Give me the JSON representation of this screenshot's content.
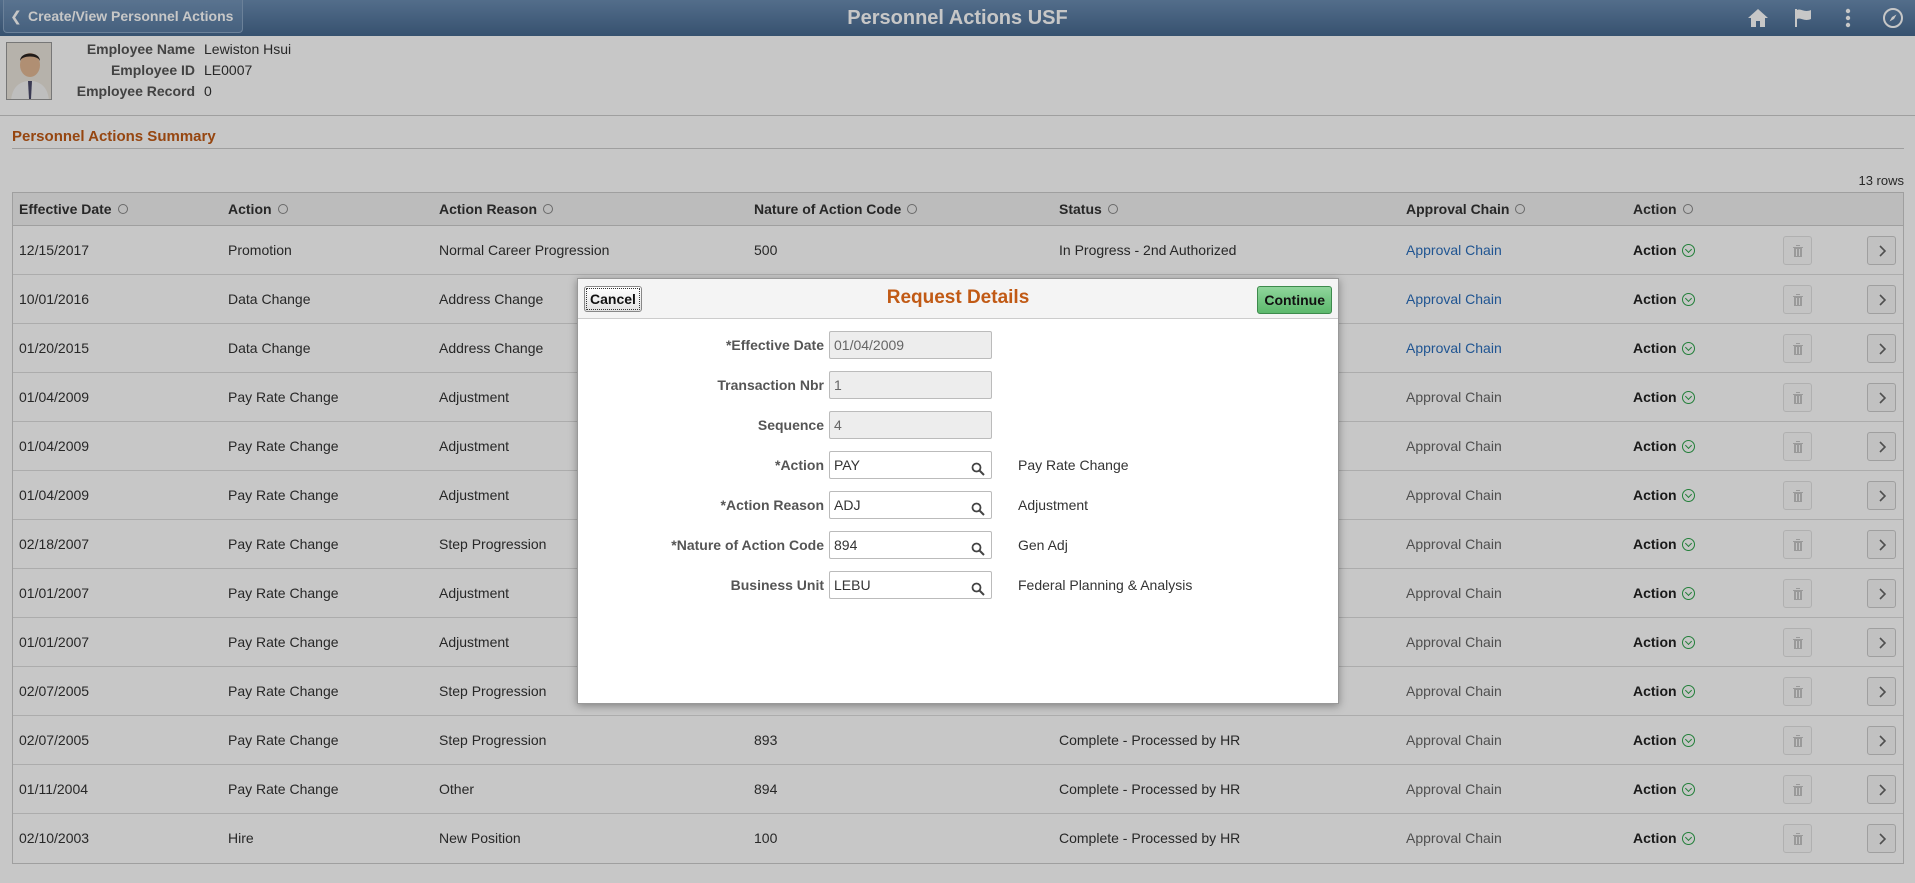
{
  "banner": {
    "back_label": "Create/View Personnel Actions",
    "title": "Personnel Actions USF",
    "icons": [
      "home-icon",
      "flag-icon",
      "more-vertical-icon",
      "navbar-compass-icon"
    ]
  },
  "employee": {
    "name_label": "Employee Name",
    "name": "Lewiston Hsui",
    "id_label": "Employee ID",
    "id": "LE0007",
    "record_label": "Employee Record",
    "record": "0"
  },
  "section": {
    "title": "Personnel Actions Summary",
    "row_count": "13 rows"
  },
  "grid": {
    "columns": [
      "Effective Date",
      "Action",
      "Action Reason",
      "Nature of Action Code",
      "Status",
      "Approval Chain",
      "Action"
    ],
    "rows": [
      {
        "date": "12/15/2017",
        "action": "Promotion",
        "reason": "Normal Career Progression",
        "noac": "500",
        "status": "In Progress - 2nd Authorized",
        "chain": "Approval Chain",
        "act": "Action"
      },
      {
        "date": "10/01/2016",
        "action": "Data Change",
        "reason": "Address Change",
        "noac": "",
        "status": "",
        "chain": "Approval Chain",
        "act": "Action"
      },
      {
        "date": "01/20/2015",
        "action": "Data Change",
        "reason": "Address Change",
        "noac": "",
        "status": "",
        "chain": "Approval Chain",
        "act": "Action"
      },
      {
        "date": "01/04/2009",
        "action": "Pay Rate Change",
        "reason": "Adjustment",
        "noac": "",
        "status": "",
        "chain": "Approval Chain",
        "act": "Action"
      },
      {
        "date": "01/04/2009",
        "action": "Pay Rate Change",
        "reason": "Adjustment",
        "noac": "",
        "status": "",
        "chain": "Approval Chain",
        "act": "Action"
      },
      {
        "date": "01/04/2009",
        "action": "Pay Rate Change",
        "reason": "Adjustment",
        "noac": "",
        "status": "",
        "chain": "Approval Chain",
        "act": "Action"
      },
      {
        "date": "02/18/2007",
        "action": "Pay Rate Change",
        "reason": "Step Progression",
        "noac": "",
        "status": "",
        "chain": "Approval Chain",
        "act": "Action"
      },
      {
        "date": "01/01/2007",
        "action": "Pay Rate Change",
        "reason": "Adjustment",
        "noac": "",
        "status": "",
        "chain": "Approval Chain",
        "act": "Action"
      },
      {
        "date": "01/01/2007",
        "action": "Pay Rate Change",
        "reason": "Adjustment",
        "noac": "",
        "status": "",
        "chain": "Approval Chain",
        "act": "Action"
      },
      {
        "date": "02/07/2005",
        "action": "Pay Rate Change",
        "reason": "Step Progression",
        "noac": "",
        "status": "",
        "chain": "Approval Chain",
        "act": "Action"
      },
      {
        "date": "02/07/2005",
        "action": "Pay Rate Change",
        "reason": "Step Progression",
        "noac": "893",
        "status": "Complete - Processed by HR",
        "chain": "Approval Chain",
        "act": "Action"
      },
      {
        "date": "01/11/2004",
        "action": "Pay Rate Change",
        "reason": "Other",
        "noac": "894",
        "status": "Complete - Processed by HR",
        "chain": "Approval Chain",
        "act": "Action"
      },
      {
        "date": "02/10/2003",
        "action": "Hire",
        "reason": "New Position",
        "noac": "100",
        "status": "Complete - Processed by HR",
        "chain": "Approval Chain",
        "act": "Action"
      }
    ],
    "linked_chain_rows": 3
  },
  "modal": {
    "title": "Request Details",
    "cancel_label": "Cancel",
    "continue_label": "Continue",
    "fields": [
      {
        "label": "*Effective Date",
        "value": "01/04/2009",
        "readonly": true,
        "lookup": false,
        "desc": ""
      },
      {
        "label": "Transaction Nbr",
        "value": "1",
        "readonly": true,
        "lookup": false,
        "desc": ""
      },
      {
        "label": "Sequence",
        "value": "4",
        "readonly": true,
        "lookup": false,
        "desc": ""
      },
      {
        "label": "*Action",
        "value": "PAY",
        "readonly": false,
        "lookup": true,
        "desc": "Pay Rate Change"
      },
      {
        "label": "*Action Reason",
        "value": "ADJ",
        "readonly": false,
        "lookup": true,
        "desc": "Adjustment"
      },
      {
        "label": "*Nature of Action Code",
        "value": "894",
        "readonly": false,
        "lookup": true,
        "desc": "Gen Adj"
      },
      {
        "label": "Business Unit",
        "value": "LEBU",
        "readonly": false,
        "lookup": true,
        "desc": "Federal Planning & Analysis"
      }
    ]
  },
  "colors": {
    "banner": "#46698f",
    "section_title": "#c15a15",
    "link": "#2a6ebb",
    "continue_button": "#5cb86c",
    "action_check": "#2ca34a"
  }
}
